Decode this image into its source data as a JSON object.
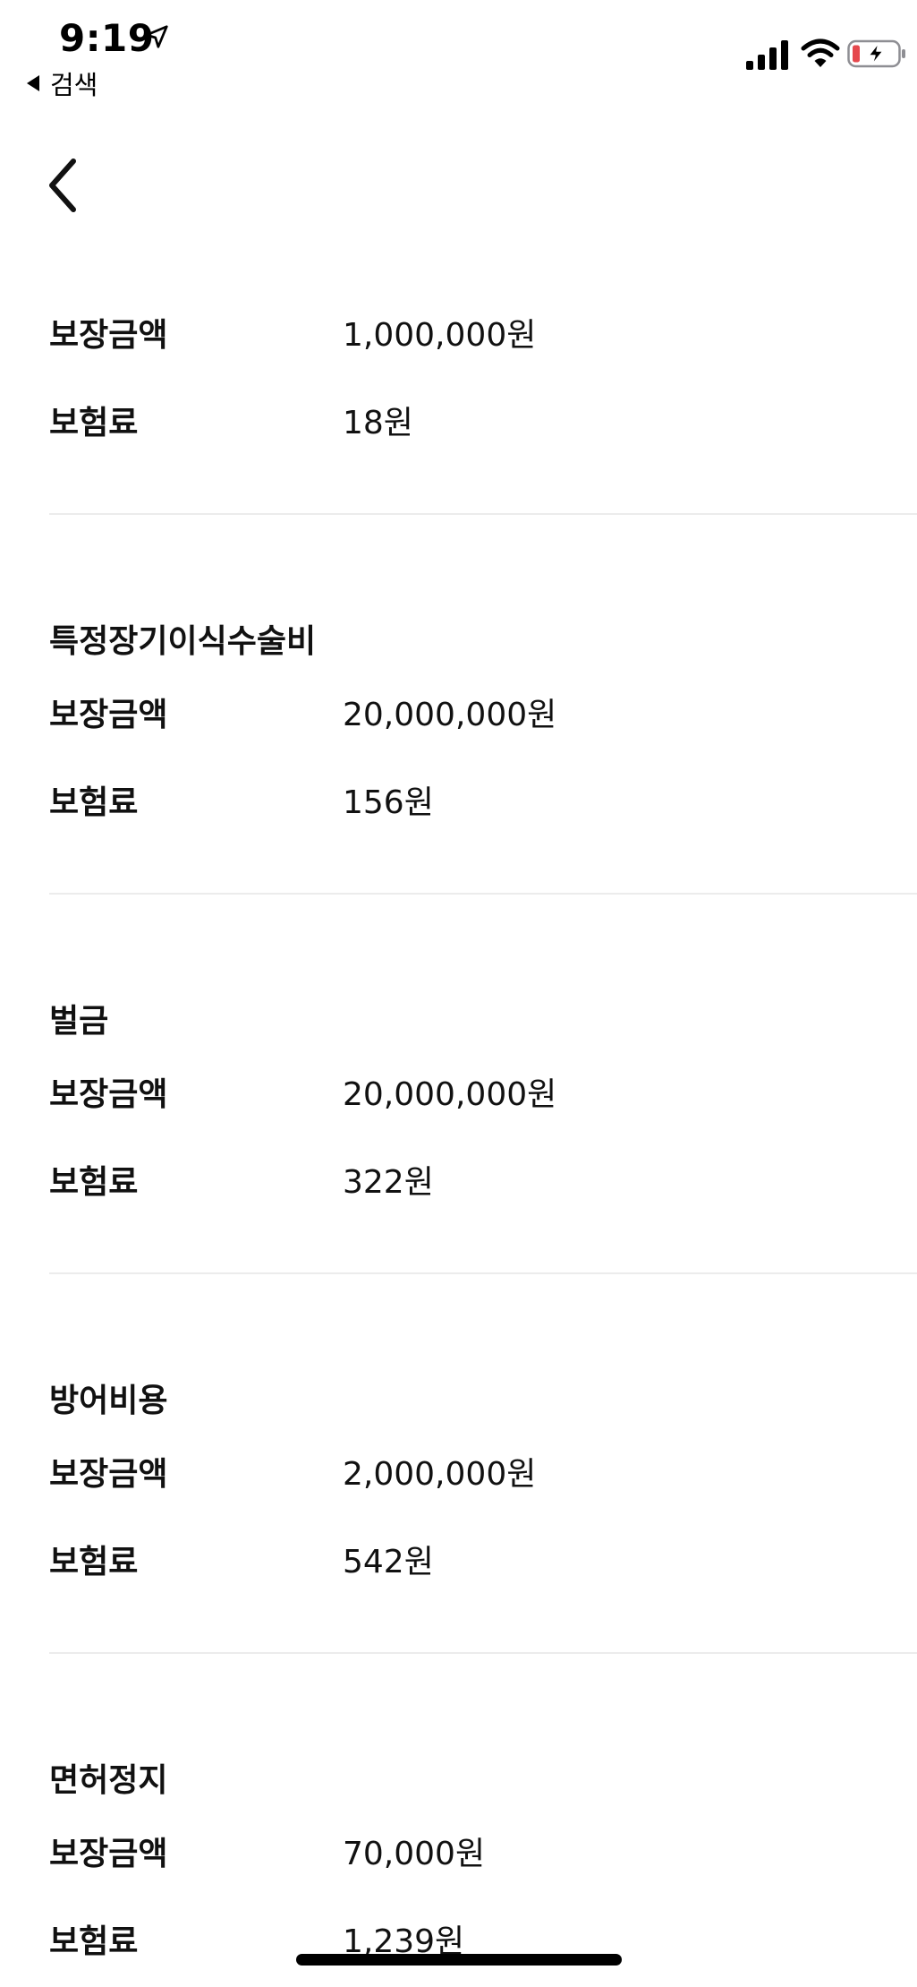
{
  "status_bar": {
    "time": "9:19",
    "back_to_app_label": "검색",
    "battery_color": "#e5484d"
  },
  "sections": [
    {
      "title": "",
      "coverage_label": "보장금액",
      "coverage_value": "1,000,000원",
      "premium_label": "보험료",
      "premium_value": "18원"
    },
    {
      "title": "특정장기이식수술비",
      "coverage_label": "보장금액",
      "coverage_value": "20,000,000원",
      "premium_label": "보험료",
      "premium_value": "156원"
    },
    {
      "title": "벌금",
      "coverage_label": "보장금액",
      "coverage_value": "20,000,000원",
      "premium_label": "보험료",
      "premium_value": "322원"
    },
    {
      "title": "방어비용",
      "coverage_label": "보장금액",
      "coverage_value": "2,000,000원",
      "premium_label": "보험료",
      "premium_value": "542원"
    },
    {
      "title": "면허정지",
      "coverage_label": "보장금액",
      "coverage_value": "70,000원",
      "premium_label": "보험료",
      "premium_value": "1,239원"
    }
  ],
  "icons": {
    "nav_back": "chevron-left-icon",
    "location": "location-arrow-icon",
    "signal": "cellular-signal-icon",
    "wifi": "wifi-icon",
    "battery": "battery-charging-icon"
  }
}
